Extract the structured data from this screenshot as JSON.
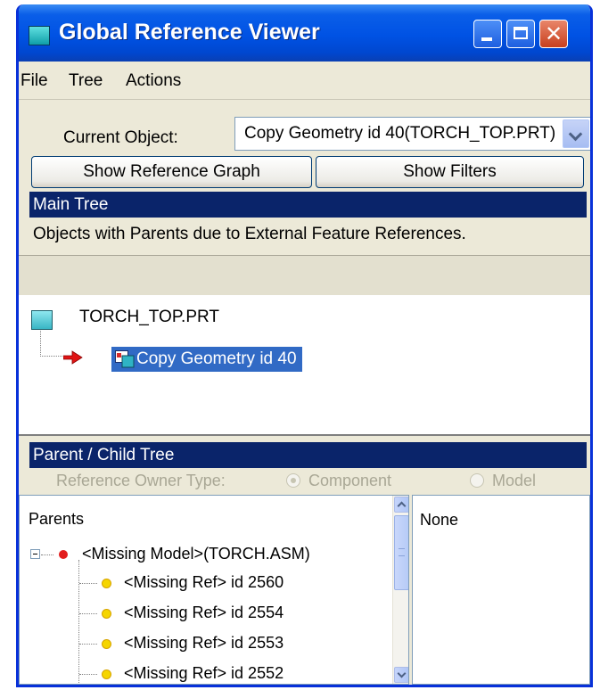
{
  "window": {
    "title": "Global Reference Viewer",
    "colors": {
      "title_bar": "#0052e4",
      "section_header": "#0a246a",
      "selection": "#316ac5"
    }
  },
  "menu": [
    "File",
    "Tree",
    "Actions"
  ],
  "current_object": {
    "label": "Current Object:",
    "value": "Copy Geometry id 40(TORCH_TOP.PRT)"
  },
  "buttons": {
    "show_reference_graph": "Show Reference Graph",
    "show_filters": "Show Filters"
  },
  "main_tree": {
    "header": "Main Tree",
    "subtitle": "Objects with Parents due to External Feature References.",
    "root": "TORCH_TOP.PRT",
    "child": "Copy Geometry id 40"
  },
  "parent_child_tree": {
    "header": "Parent / Child Tree",
    "owner_type_label": "Reference Owner Type:",
    "option_component": "Component",
    "option_model": "Model",
    "selected_option": "Component",
    "parents_title": "Parents",
    "parents": [
      {
        "label": "<Missing Model>(TORCH.ASM)",
        "level": 0
      },
      {
        "label": "<Missing Ref> id 2560",
        "level": 1
      },
      {
        "label": "<Missing Ref> id 2554",
        "level": 1
      },
      {
        "label": "<Missing Ref> id 2553",
        "level": 1
      },
      {
        "label": "<Missing Ref> id 2552",
        "level": 1
      }
    ],
    "children_value": "None"
  }
}
